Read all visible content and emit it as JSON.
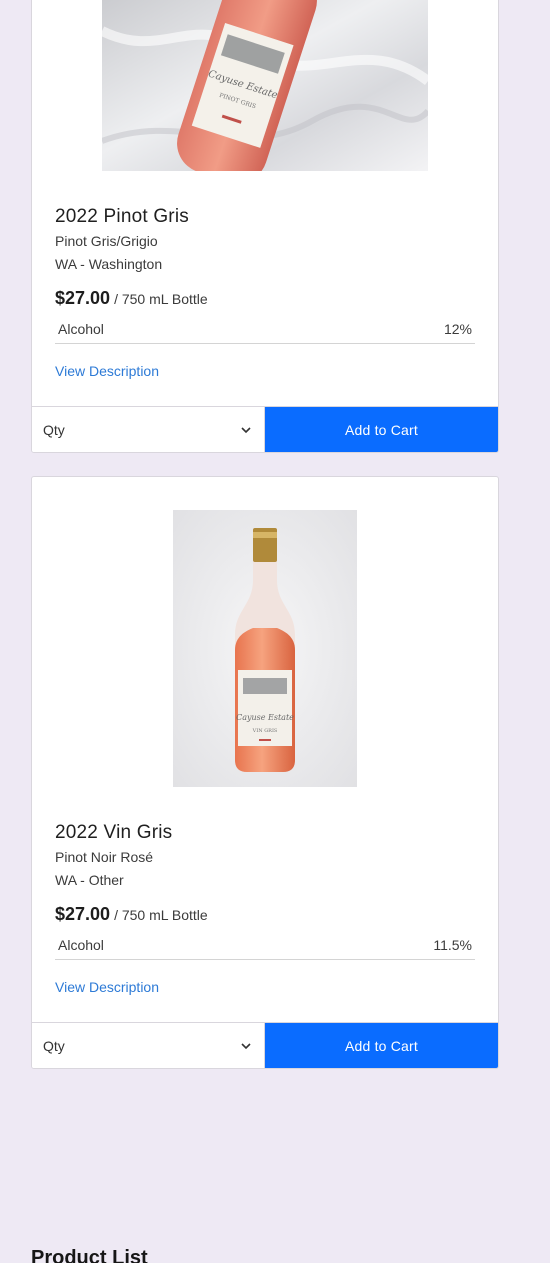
{
  "products": [
    {
      "image_icon": "rose-wine-bottle-photo",
      "name": "2022 Pinot Gris",
      "varietal": "Pinot Gris/Grigio",
      "region": "WA - Washington",
      "price": "$27.00",
      "unit": "/ 750 mL Bottle",
      "attribute_label": "Alcohol",
      "attribute_value": "12%",
      "description_link": "View Description",
      "qty_label": "Qty",
      "add_to_cart_label": "Add to Cart"
    },
    {
      "image_icon": "rose-wine-bottle-photo",
      "name": "2022 Vin Gris",
      "varietal": "Pinot Noir Rosé",
      "region": "WA - Other",
      "price": "$27.00",
      "unit": "/ 750 mL Bottle",
      "attribute_label": "Alcohol",
      "attribute_value": "11.5%",
      "description_link": "View Description",
      "qty_label": "Qty",
      "add_to_cart_label": "Add to Cart"
    }
  ],
  "section_title": "Product List",
  "colors": {
    "background": "#eee9f4",
    "accent_button": "#0a6cff",
    "link": "#2d7ad6"
  }
}
